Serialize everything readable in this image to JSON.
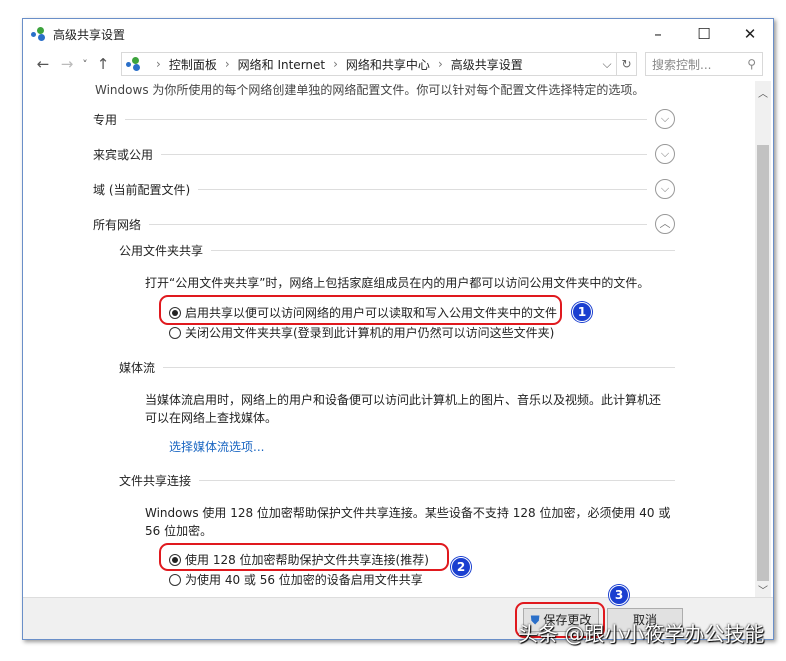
{
  "window": {
    "title": "高级共享设置",
    "minimize": "–",
    "maximize": "☐",
    "close": "✕"
  },
  "nav": {
    "back": "←",
    "forward": "→",
    "recent": "˅",
    "up": "↑",
    "breadcrumb": [
      "控制面板",
      "网络和 Internet",
      "网络和共享中心",
      "高级共享设置"
    ],
    "search_placeholder": "搜索控制...",
    "search_icon": "⚲",
    "refresh": "↻",
    "dropdown": "⌵"
  },
  "intro": "Windows 为你所使用的每个网络创建单独的网络配置文件。你可以针对每个配置文件选择特定的选项。",
  "profiles": [
    {
      "label": "专用",
      "state": "collapsed"
    },
    {
      "label": "来宾或公用",
      "state": "collapsed"
    },
    {
      "label": "域 (当前配置文件)",
      "state": "collapsed"
    },
    {
      "label": "所有网络",
      "state": "expanded"
    }
  ],
  "public_folder": {
    "heading": "公用文件夹共享",
    "desc": "打开“公用文件夹共享”时，网络上包括家庭组成员在内的用户都可以访问公用文件夹中的文件。",
    "options": [
      {
        "label": "启用共享以便可以访问网络的用户可以读取和写入公用文件夹中的文件",
        "selected": true
      },
      {
        "label": "关闭公用文件夹共享(登录到此计算机的用户仍然可以访问这些文件夹)",
        "selected": false
      }
    ]
  },
  "media": {
    "heading": "媒体流",
    "desc1": "当媒体流启用时，网络上的用户和设备便可以访问此计算机上的图片、音乐以及视频。此计算机还",
    "desc2": "可以在网络上查找媒体。",
    "link": "选择媒体流选项..."
  },
  "file_sharing": {
    "heading": "文件共享连接",
    "desc1": "Windows 使用 128 位加密帮助保护文件共享连接。某些设备不支持 128 位加密，必须使用 40 或",
    "desc2": "56 位加密。",
    "options": [
      {
        "label": "使用 128 位加密帮助保护文件共享连接(推荐)",
        "selected": true
      },
      {
        "label": "为使用 40 或 56 位加密的设备启用文件共享",
        "selected": false
      }
    ]
  },
  "annotations": [
    "1",
    "2",
    "3"
  ],
  "footer": {
    "save": "保存更改",
    "cancel": "取消"
  },
  "watermark": "头条 @跟小小筱学办公技能",
  "colors": {
    "highlight": "#e0191e",
    "badge": "#1a3fd0",
    "link": "#1a66c2"
  }
}
